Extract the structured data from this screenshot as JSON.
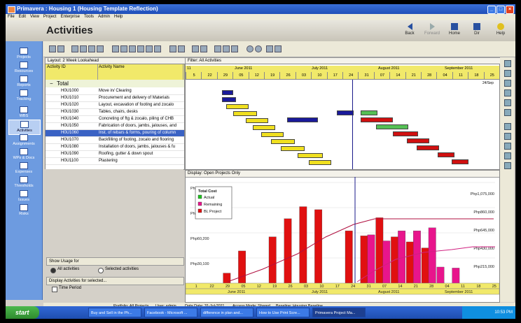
{
  "window": {
    "title": "Primavera : Housing 1 (Housing Template Reflection)"
  },
  "menu": [
    "File",
    "Edit",
    "View",
    "Project",
    "Enterprise",
    "Tools",
    "Admin",
    "Help"
  ],
  "header": {
    "title": "Activities",
    "back": "Back",
    "forward": "Forward",
    "home": "Home",
    "dir": "Dir",
    "help": "Help"
  },
  "sidebar": [
    "Projects",
    "Resources",
    "Reports",
    "Tracking",
    "WBS",
    "Activities",
    "Assignments",
    "WPs & Docs",
    "Expenses",
    "Thresholds",
    "Issues",
    "Risks"
  ],
  "layout_label": "Layout: 2 Week Lookahead",
  "filter_label": "Filter: All Activities",
  "table": {
    "col_id": "Activity ID",
    "col_name": "Activity Name",
    "total": "Total",
    "rows": [
      {
        "id": "H0U1000",
        "name": "Move in/ Clearing"
      },
      {
        "id": "H0U1010",
        "name": "Procurement and delivery of Materials"
      },
      {
        "id": "H0U1020",
        "name": "Layout, excavation of footing and zocalo"
      },
      {
        "id": "H0U1030",
        "name": "Tables, chairs, desks"
      },
      {
        "id": "H0U1040",
        "name": "Concreting of ftg & zocalo, piling of CHB"
      },
      {
        "id": "H0U1050",
        "name": "Fabrication of doors, jambs, jalouses, and"
      },
      {
        "id": "H0U1060",
        "name": "Inst. of rebars & forms, pouring of column"
      },
      {
        "id": "H0U1070",
        "name": "Backfilling of footing, zocalo and flooring"
      },
      {
        "id": "H0U1080",
        "name": "Installation of doors, jambs, jalouses & fu"
      },
      {
        "id": "H0U1090",
        "name": "Roofing, gutter & down spout"
      },
      {
        "id": "H0U1100",
        "name": "Plastering"
      }
    ]
  },
  "timescale": {
    "year_tag": "11",
    "months": [
      "June 2011",
      "July 2011",
      "August 2011",
      "September 2011"
    ],
    "days": [
      "5",
      "22",
      "29",
      "05",
      "12",
      "19",
      "26",
      "03",
      "10",
      "17",
      "24",
      "31",
      "07",
      "14",
      "21",
      "28",
      "04",
      "11",
      "18",
      "25"
    ],
    "bottom_days": [
      "1",
      "22",
      "29",
      "05",
      "12",
      "19",
      "26",
      "03",
      "10",
      "17",
      "24",
      "31",
      "07",
      "14",
      "21",
      "28",
      "04",
      "11",
      "18",
      "25"
    ],
    "end_label": "24/Sep"
  },
  "usage": {
    "show_usage": "Show Usage for",
    "all": "All activities",
    "selected": "Selected activities",
    "display_for": "Display Activities for selected...",
    "time_period": "Time Period"
  },
  "chart_display_label": "Display: Open Projects Only",
  "chart_data": {
    "type": "bar",
    "legend": {
      "title": "Total Cost",
      "items": [
        {
          "name": "Actual",
          "color": "#1ec21e"
        },
        {
          "name": "Remaining",
          "color": "#e8158c"
        },
        {
          "name": "BL Project",
          "color": "#e01010"
        }
      ]
    },
    "left_ticks": [
      "Php120,000",
      "Php90,300",
      "Php60,200",
      "Php30,100"
    ],
    "right_ticks": [
      "Php1,075,000",
      "Php860,000",
      "Php645,000",
      "Php430,000",
      "Php215,000"
    ],
    "categories": [
      "22",
      "29",
      "05",
      "12",
      "19",
      "26",
      "03",
      "10",
      "17",
      "24",
      "31",
      "07",
      "14",
      "21",
      "28",
      "04",
      "11",
      "18"
    ],
    "series": [
      {
        "name": "BL Project",
        "values": [
          0,
          10,
          32,
          0,
          46,
          64,
          76,
          73,
          0,
          52,
          47,
          65,
          46,
          41,
          35,
          0,
          0,
          0
        ]
      },
      {
        "name": "Remaining",
        "values": [
          0,
          0,
          0,
          0,
          0,
          0,
          0,
          0,
          0,
          0,
          48,
          42,
          52,
          52,
          55,
          16,
          15,
          0
        ]
      }
    ],
    "bar_heights_pct": [
      [
        0,
        10,
        0
      ],
      [
        1,
        32,
        0
      ],
      [
        2,
        0,
        0
      ]
    ],
    "ylim": [
      0,
      120000
    ]
  },
  "status": {
    "portfolio": "Portfolio: All Projects",
    "user": "User: admin",
    "data_date": "Data Date: 31-Jul-2011",
    "access": "Access Mode: Shared",
    "baseline": "Baseline: Housing Baseline"
  },
  "taskbar": {
    "start": "start",
    "tasks": [
      "Buy and Sell in the Ph...",
      "Facebook - Microsoft ...",
      "difference in plan and...",
      "How to Use Print Scre...",
      "Primavera Project Ma..."
    ],
    "time": "10:53 PM"
  }
}
